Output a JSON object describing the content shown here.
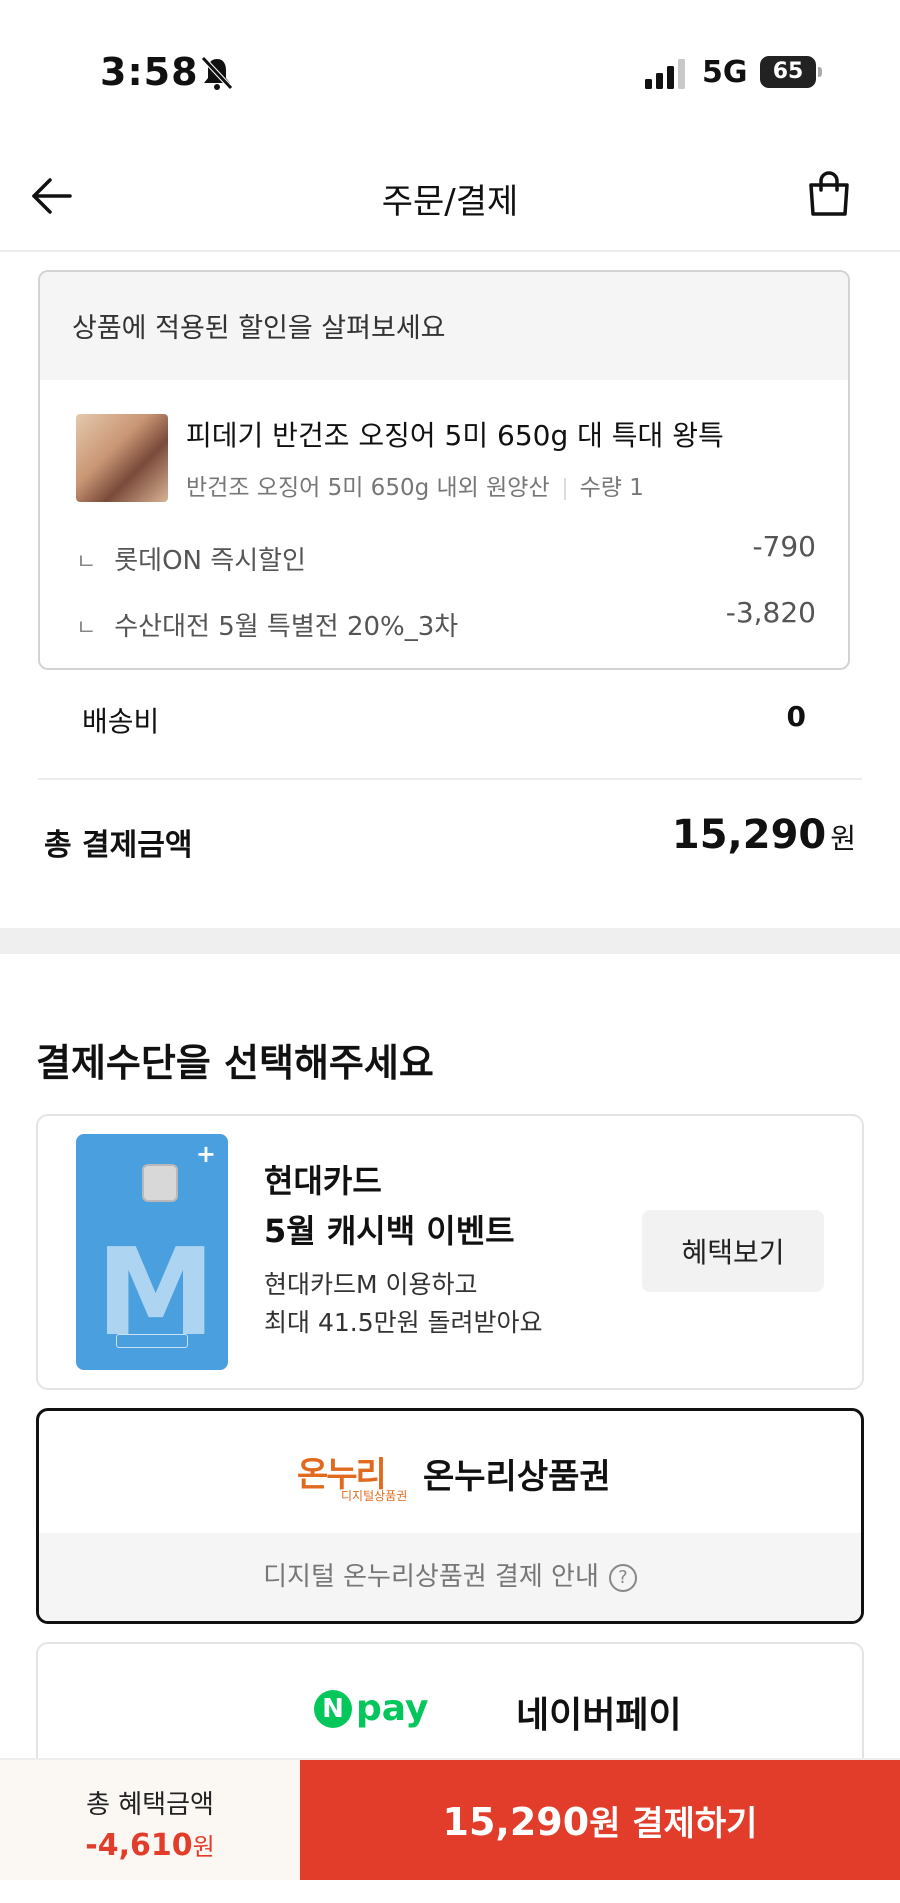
{
  "status_bar": {
    "time": "3:58",
    "network": "5G",
    "battery": "65"
  },
  "header": {
    "title": "주문/결제"
  },
  "discount_box": {
    "heading": "상품에 적용된 할인을 살펴보세요",
    "product": {
      "name": "피데기 반건조 오징어 5미 650g 대 특대 왕특",
      "option": "반건조 오징어 5미 650g 내외 원양산",
      "quantity": "수량 1"
    },
    "discounts": [
      {
        "label": "롯데ON 즉시할인",
        "value": "-790"
      },
      {
        "label": "수산대전 5월 특별전 20%_3차",
        "value": "-3,820"
      }
    ]
  },
  "shipping": {
    "label": "배송비",
    "value": "0"
  },
  "total": {
    "label": "총 결제금액",
    "value": "15,290",
    "unit": "원"
  },
  "payment": {
    "title": "결제수단을 선택해주세요",
    "card_promo": {
      "title_line1": "현대카드",
      "title_line2": "5월 캐시백 이벤트",
      "desc_line1": "현대카드M 이용하고",
      "desc_line2": "최대 41.5만원 돌려받아요",
      "button": "혜택보기",
      "card_letter": "M",
      "card_plus": "+"
    },
    "onnuri": {
      "logo_text": "온누리",
      "logo_sub": "디지털상품권",
      "name": "온누리상품권",
      "guide": "디지털 온누리상품권 결제 안내",
      "help": "?"
    },
    "npay": {
      "logo_n": "N",
      "logo_pay": "pay",
      "name": "네이버페이"
    }
  },
  "bottom_bar": {
    "benefit_label": "총 혜택금액",
    "benefit_amount": "-4,610",
    "benefit_unit": "원",
    "pay_amount": "15,290",
    "pay_suffix": "원 결제하기"
  },
  "colors": {
    "accent": "#e23c2b",
    "npay_green": "#03c75a",
    "onnuri_orange": "#e06b1f"
  }
}
